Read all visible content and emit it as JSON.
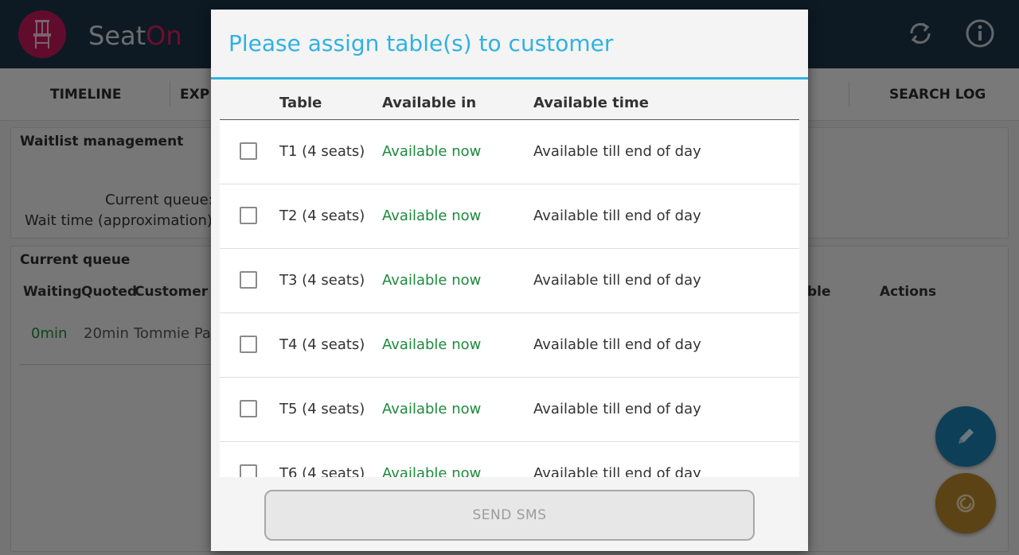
{
  "app": {
    "name_part1": "Seat",
    "name_part2": "On",
    "brand_color": "#e5195f",
    "topbar_color": "#1b3447",
    "icons": [
      "chair-icon",
      "refresh-icon",
      "info-icon"
    ]
  },
  "nav": {
    "timeline": "TIMELINE",
    "explore_partial": "EXP",
    "search_log": "SEARCH LOG"
  },
  "waitlist": {
    "title": "Waitlist management",
    "current_queue_label": "Current queue:",
    "wait_time_label": "Wait time (approximation):"
  },
  "queue": {
    "title": "Current queue",
    "col_waiting": "Waiting",
    "col_quoted": "Quoted",
    "col_customer": "Customer",
    "col_table_partial": "ble",
    "col_actions": "Actions",
    "row": {
      "waiting": "0min",
      "quoted": "20min",
      "customer": "Tommie Pa"
    }
  },
  "fabs": [
    {
      "name": "edit",
      "color": "#1b7eb0",
      "icon": "pencil-icon"
    },
    {
      "name": "clock",
      "color": "#b8862a",
      "icon": "clock-icon"
    }
  ],
  "dialog": {
    "title": "Please assign table(s) to customer",
    "accent": "#2fb2e0",
    "headers": {
      "table": "Table",
      "available_in": "Available in",
      "available_time": "Available time"
    },
    "rows": [
      {
        "table": "T1 (4 seats)",
        "available_in": "Available now",
        "available_time": "Available till end of day",
        "checked": false
      },
      {
        "table": "T2 (4 seats)",
        "available_in": "Available now",
        "available_time": "Available till end of day",
        "checked": false
      },
      {
        "table": "T3 (4 seats)",
        "available_in": "Available now",
        "available_time": "Available till end of day",
        "checked": false
      },
      {
        "table": "T4 (4 seats)",
        "available_in": "Available now",
        "available_time": "Available till end of day",
        "checked": false
      },
      {
        "table": "T5 (4 seats)",
        "available_in": "Available now",
        "available_time": "Available till end of day",
        "checked": false
      },
      {
        "table": "T6 (4 seats)",
        "available_in": "Available now",
        "available_time": "Available till end of day",
        "checked": false
      }
    ],
    "send_button": "SEND SMS"
  }
}
